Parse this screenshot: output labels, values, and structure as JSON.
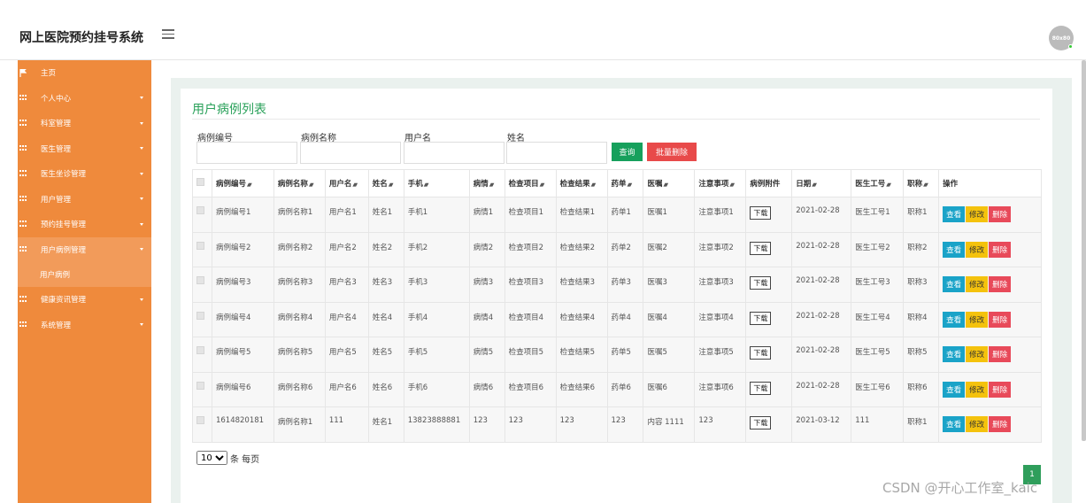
{
  "app": {
    "title": "网上医院预约挂号系统",
    "avatar_text": "80x80"
  },
  "sidebar": {
    "items": [
      {
        "label": "主页",
        "icon": "flag-icon"
      },
      {
        "label": "个人中心"
      },
      {
        "label": "科室管理"
      },
      {
        "label": "医生管理"
      },
      {
        "label": "医生坐诊管理"
      },
      {
        "label": "用户管理"
      },
      {
        "label": "预约挂号管理"
      },
      {
        "label": "用户病例管理",
        "active": true
      },
      {
        "label": "健康资讯管理"
      },
      {
        "label": "系统管理"
      }
    ],
    "sub_item": "用户病例"
  },
  "panel": {
    "title": "用户病例列表"
  },
  "filters": {
    "f1": "病例编号",
    "f2": "病例名称",
    "f3": "用户名",
    "f4": "姓名",
    "query_btn": "查询",
    "bulk_delete_btn": "批量删除"
  },
  "table": {
    "headers": [
      "病例编号",
      "病例名称",
      "用户名",
      "姓名",
      "手机",
      "病情",
      "检查项目",
      "检查结果",
      "药单",
      "医嘱",
      "注意事项",
      "病例附件",
      "日期",
      "医生工号",
      "职称",
      "操作"
    ],
    "sortable": [
      true,
      true,
      true,
      true,
      true,
      true,
      true,
      true,
      true,
      true,
      true,
      false,
      true,
      true,
      true,
      false
    ],
    "download_label": "下载",
    "view_label": "查看",
    "edit_label": "修改",
    "delete_label": "删除",
    "rows": [
      [
        "病例编号1",
        "病例名称1",
        "用户名1",
        "姓名1",
        "手机1",
        "病情1",
        "检查项目1",
        "检查结果1",
        "药单1",
        "医嘱1",
        "注意事项1",
        "2021-02-28",
        "医生工号1",
        "职称1"
      ],
      [
        "病例编号2",
        "病例名称2",
        "用户名2",
        "姓名2",
        "手机2",
        "病情2",
        "检查项目2",
        "检查结果2",
        "药单2",
        "医嘱2",
        "注意事项2",
        "2021-02-28",
        "医生工号2",
        "职称2"
      ],
      [
        "病例编号3",
        "病例名称3",
        "用户名3",
        "姓名3",
        "手机3",
        "病情3",
        "检查项目3",
        "检查结果3",
        "药单3",
        "医嘱3",
        "注意事项3",
        "2021-02-28",
        "医生工号3",
        "职称3"
      ],
      [
        "病例编号4",
        "病例名称4",
        "用户名4",
        "姓名4",
        "手机4",
        "病情4",
        "检查项目4",
        "检查结果4",
        "药单4",
        "医嘱4",
        "注意事项4",
        "2021-02-28",
        "医生工号4",
        "职称4"
      ],
      [
        "病例编号5",
        "病例名称5",
        "用户名5",
        "姓名5",
        "手机5",
        "病情5",
        "检查项目5",
        "检查结果5",
        "药单5",
        "医嘱5",
        "注意事项5",
        "2021-02-28",
        "医生工号5",
        "职称5"
      ],
      [
        "病例编号6",
        "病例名称6",
        "用户名6",
        "姓名6",
        "手机6",
        "病情6",
        "检查项目6",
        "检查结果6",
        "药单6",
        "医嘱6",
        "注意事项6",
        "2021-02-28",
        "医生工号6",
        "职称6"
      ],
      [
        "1614820181",
        "病例名称1",
        "111",
        "姓名1",
        "13823888881",
        "123",
        "123",
        "123",
        "123",
        "内容 1111",
        "123",
        "2021-03-12",
        "111",
        "职称1"
      ]
    ]
  },
  "pager": {
    "page_size": "10",
    "per_page_label": "条 每页",
    "current_page": "1"
  },
  "watermark": "CSDN @开心工作室_kaic",
  "colors": {
    "sidebar": "#ef8a3c",
    "title_green": "#2aa15a",
    "query": "#16a05c",
    "bulk_delete": "#e84a4a"
  }
}
